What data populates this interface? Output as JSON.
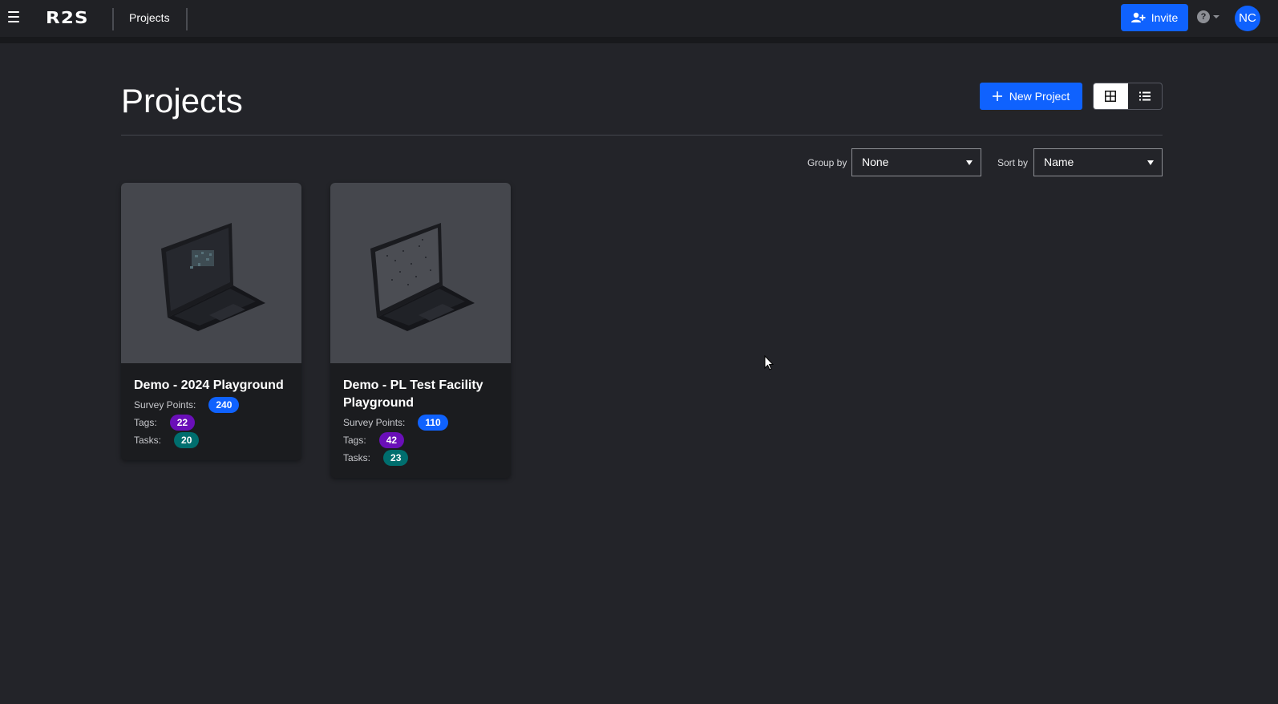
{
  "app": {
    "logo": "R2S",
    "breadcrumb": "Projects"
  },
  "header": {
    "invite_label": "Invite",
    "help_icon": "question-circle-icon",
    "avatar_initials": "NC"
  },
  "page": {
    "title": "Projects",
    "new_project_label": "New Project",
    "view_modes": [
      "grid-view",
      "list-view"
    ],
    "active_view": "grid-view"
  },
  "filters": {
    "group_by_label": "Group by",
    "group_by_value": "None",
    "sort_by_label": "Sort by",
    "sort_by_value": "Name"
  },
  "projects": [
    {
      "name": "Demo - 2024 Playground",
      "survey_points_label": "Survey Points:",
      "survey_points": "240",
      "tags_label": "Tags:",
      "tags": "22",
      "tasks_label": "Tasks:",
      "tasks": "20"
    },
    {
      "name": "Demo - PL Test Facility Playground",
      "survey_points_label": "Survey Points:",
      "survey_points": "110",
      "tags_label": "Tags:",
      "tags": "42",
      "tasks_label": "Tasks:",
      "tasks": "23"
    }
  ],
  "colors": {
    "accent": "#0f62fe",
    "survey_badge": "#0f62fe",
    "tags_badge": "#6a0fb8",
    "tasks_badge": "#006e6e",
    "background": "#232429",
    "card": "#1b1c1f"
  }
}
